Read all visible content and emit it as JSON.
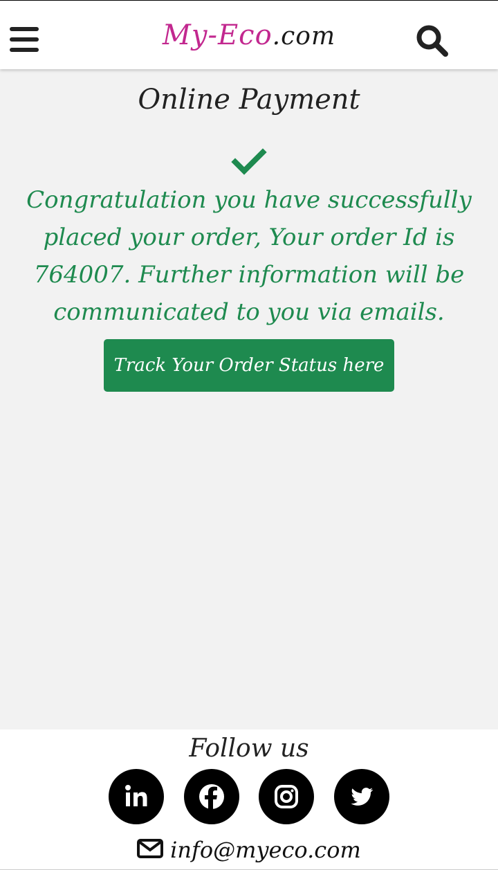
{
  "header": {
    "logo_part1": "My-Eco",
    "logo_part2": ".com",
    "menu_icon": "hamburger-menu-icon",
    "search_icon": "search-icon"
  },
  "main": {
    "title": "Online Payment",
    "success_icon": "checkmark-icon",
    "message": "Congratulation you have successfully placed your order, Your order Id is 764007. Further information will be communicated to you via emails.",
    "track_button_label": "Track Your Order Status here"
  },
  "footer": {
    "follow_label": "Follow us",
    "social": [
      {
        "name": "linkedin",
        "icon": "linkedin-icon"
      },
      {
        "name": "facebook",
        "icon": "facebook-icon"
      },
      {
        "name": "instagram",
        "icon": "instagram-icon"
      },
      {
        "name": "twitter",
        "icon": "twitter-icon"
      }
    ],
    "email_icon": "envelope-icon",
    "email": "info@myeco.com"
  },
  "colors": {
    "accent_green": "#1e8a4f",
    "logo_magenta": "#c2288f",
    "background": "#f2f2f2"
  }
}
